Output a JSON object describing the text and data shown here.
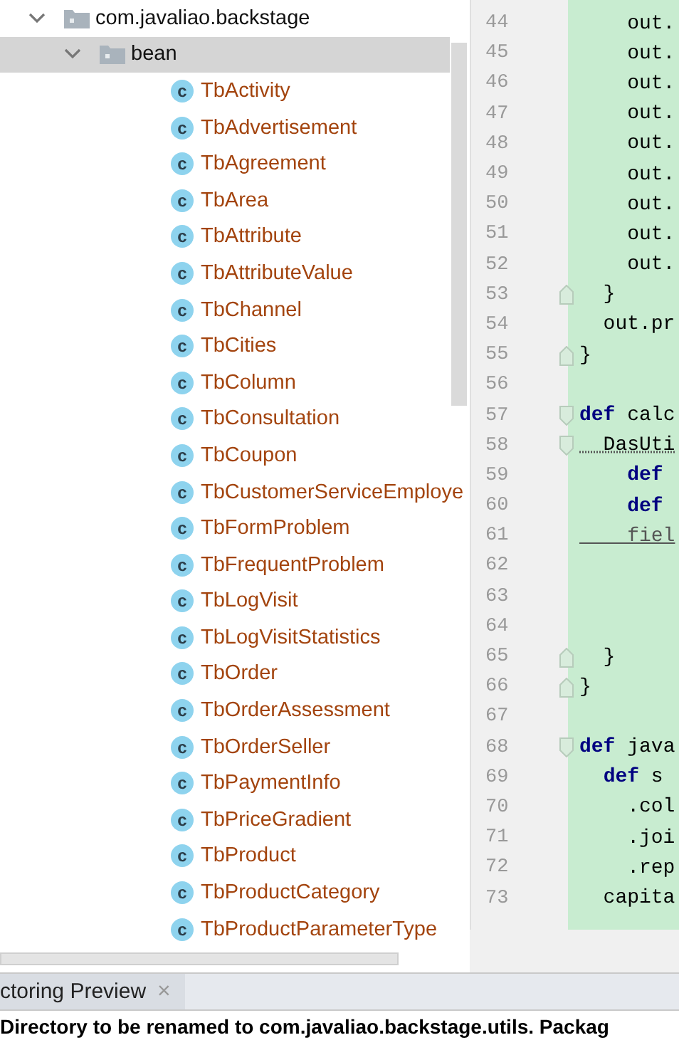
{
  "project_tree": {
    "items": [
      {
        "kind": "package",
        "label": "com.javaliao.backstage",
        "expanded": true,
        "selected": false,
        "children": [
          {
            "kind": "package",
            "label": "bean",
            "expanded": true,
            "selected": true,
            "children": [
              {
                "kind": "class",
                "icon_label": "c",
                "label": "TbActivity",
                "selected": false
              },
              {
                "kind": "class",
                "icon_label": "c",
                "label": "TbAdvertisement",
                "selected": false
              },
              {
                "kind": "class",
                "icon_label": "c",
                "label": "TbAgreement",
                "selected": false
              },
              {
                "kind": "class",
                "icon_label": "c",
                "label": "TbArea",
                "selected": false
              },
              {
                "kind": "class",
                "icon_label": "c",
                "label": "TbAttribute",
                "selected": false
              },
              {
                "kind": "class",
                "icon_label": "c",
                "label": "TbAttributeValue",
                "selected": false
              },
              {
                "kind": "class",
                "icon_label": "c",
                "label": "TbChannel",
                "selected": false
              },
              {
                "kind": "class",
                "icon_label": "c",
                "label": "TbCities",
                "selected": false
              },
              {
                "kind": "class",
                "icon_label": "c",
                "label": "TbColumn",
                "selected": false
              },
              {
                "kind": "class",
                "icon_label": "c",
                "label": "TbConsultation",
                "selected": false
              },
              {
                "kind": "class",
                "icon_label": "c",
                "label": "TbCoupon",
                "selected": false
              },
              {
                "kind": "class",
                "icon_label": "c",
                "label": "TbCustomerServiceEmploye",
                "selected": false
              },
              {
                "kind": "class",
                "icon_label": "c",
                "label": "TbFormProblem",
                "selected": false
              },
              {
                "kind": "class",
                "icon_label": "c",
                "label": "TbFrequentProblem",
                "selected": false
              },
              {
                "kind": "class",
                "icon_label": "c",
                "label": "TbLogVisit",
                "selected": false
              },
              {
                "kind": "class",
                "icon_label": "c",
                "label": "TbLogVisitStatistics",
                "selected": false
              },
              {
                "kind": "class",
                "icon_label": "c",
                "label": "TbOrder",
                "selected": false
              },
              {
                "kind": "class",
                "icon_label": "c",
                "label": "TbOrderAssessment",
                "selected": false
              },
              {
                "kind": "class",
                "icon_label": "c",
                "label": "TbOrderSeller",
                "selected": false
              },
              {
                "kind": "class",
                "icon_label": "c",
                "label": "TbPaymentInfo",
                "selected": false
              },
              {
                "kind": "class",
                "icon_label": "c",
                "label": "TbPriceGradient",
                "selected": false
              },
              {
                "kind": "class",
                "icon_label": "c",
                "label": "TbProduct",
                "selected": false
              },
              {
                "kind": "class",
                "icon_label": "c",
                "label": "TbProductCategory",
                "selected": false
              },
              {
                "kind": "class",
                "icon_label": "c",
                "label": "TbProductParameterType",
                "selected": false
              }
            ]
          }
        ]
      }
    ]
  },
  "editor": {
    "lines": [
      {
        "number": "44",
        "text": "    out."
      },
      {
        "number": "45",
        "text": "    out."
      },
      {
        "number": "46",
        "text": "    out."
      },
      {
        "number": "47",
        "text": "    out."
      },
      {
        "number": "48",
        "text": "    out."
      },
      {
        "number": "49",
        "text": "    out."
      },
      {
        "number": "50",
        "text": "    out."
      },
      {
        "number": "51",
        "text": "    out."
      },
      {
        "number": "52",
        "text": "    out."
      },
      {
        "number": "53",
        "text": "  }",
        "fold_close": true
      },
      {
        "number": "54",
        "text": "  out.pr"
      },
      {
        "number": "55",
        "text": "}",
        "fold_close": true
      },
      {
        "number": "56"
      },
      {
        "number": "57",
        "text": "**def** calc",
        "fold_open": true
      },
      {
        "number": "58",
        "text": "  DasUti",
        "fold_open": true,
        "warning": true
      },
      {
        "number": "59",
        "text": "    **def**"
      },
      {
        "number": "60",
        "text": "    **def**"
      },
      {
        "number": "61",
        "text": "    fiel",
        "underlined": true
      },
      {
        "number": "62"
      },
      {
        "number": "63"
      },
      {
        "number": "64"
      },
      {
        "number": "65",
        "text": "  }",
        "fold_close": true
      },
      {
        "number": "66",
        "text": "}",
        "fold_close": true
      },
      {
        "number": "67"
      },
      {
        "number": "68",
        "text": "**def** java",
        "fold_open": true
      },
      {
        "number": "69",
        "text": "  **def** s"
      },
      {
        "number": "70",
        "text": "    .col"
      },
      {
        "number": "71",
        "text": "    .joi"
      },
      {
        "number": "72",
        "text": "    .rep"
      },
      {
        "number": "73",
        "text": "  capita"
      }
    ]
  },
  "bottom_panel": {
    "tabs": [
      {
        "label": "ctoring Preview",
        "close": "×",
        "selected": true
      }
    ],
    "message": "Directory to be renamed to com.javaliao.backstage.utils. Packag"
  }
}
